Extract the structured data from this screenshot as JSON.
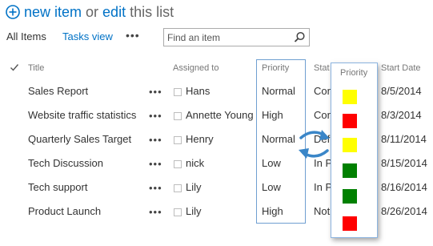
{
  "header": {
    "new_item_label": "new item",
    "or_label": "or",
    "edit_label": "edit",
    "this_list_label": "this list"
  },
  "views": {
    "all_items": "All Items",
    "tasks_view": "Tasks view",
    "more": "•••"
  },
  "search": {
    "placeholder": "Find an item",
    "value": ""
  },
  "columns": {
    "title": "Title",
    "assigned_to": "Assigned to",
    "priority": "Priority",
    "status": "Stat",
    "start_date": "Start Date"
  },
  "rows": [
    {
      "title": "Sales Report",
      "assigned_to": "Hans",
      "priority": "Normal",
      "status": "Con",
      "start_date": "8/5/2014"
    },
    {
      "title": "Website traffic statistics",
      "assigned_to": "Annette Young",
      "priority": "High",
      "status": "Con",
      "start_date": "8/3/2014"
    },
    {
      "title": "Quarterly Sales Target",
      "assigned_to": "Henry",
      "priority": "Normal",
      "status": "Def",
      "start_date": "8/11/2014"
    },
    {
      "title": "Tech Discussion",
      "assigned_to": "nick",
      "priority": "Low",
      "status": "In P",
      "start_date": "8/15/2014"
    },
    {
      "title": "Tech support",
      "assigned_to": "Lily",
      "priority": "Low",
      "status": "In P",
      "start_date": "8/16/2014"
    },
    {
      "title": "Product Launch",
      "assigned_to": "Lily",
      "priority": "High",
      "status": "Not",
      "start_date": "8/26/2014"
    }
  ],
  "row_more": "•••",
  "color_panel": {
    "header": "Priority",
    "swatches": [
      {
        "priority": "Normal",
        "color": "#ffff00"
      },
      {
        "priority": "High",
        "color": "#ff0000"
      },
      {
        "priority": "Normal",
        "color": "#ffff00"
      },
      {
        "priority": "Low",
        "color": "#008000"
      },
      {
        "priority": "Low",
        "color": "#008000"
      },
      {
        "priority": "High",
        "color": "#ff0000"
      }
    ]
  },
  "colors": {
    "accent": "#0072c6",
    "highlight_border": "#6f9fd1",
    "swap_arrow": "#3a86c8"
  },
  "icons": [
    "plus-circle-icon",
    "search-icon",
    "checkmark-icon",
    "swap-arrows-icon"
  ]
}
